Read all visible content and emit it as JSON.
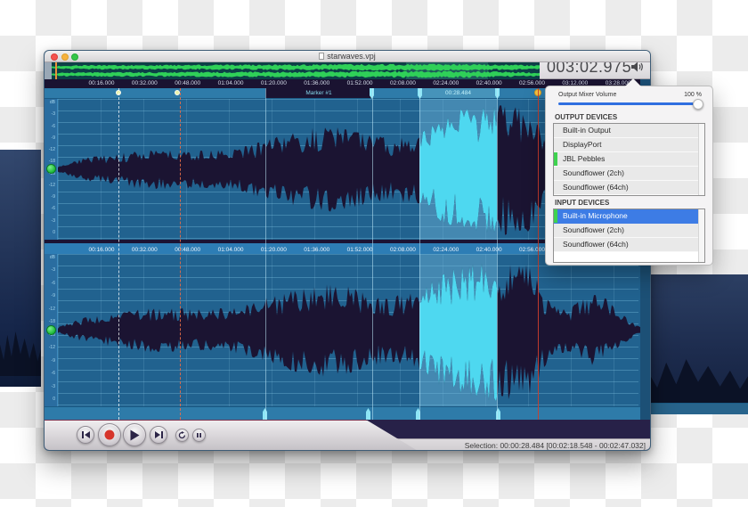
{
  "window": {
    "title": "starwaves.vpj",
    "time_display": "003:02.975",
    "traffic_lights": [
      "close",
      "minimize",
      "zoom"
    ],
    "ruler_ticks": [
      "00:16.000",
      "00:32.000",
      "00:48.000",
      "01:04.000",
      "01:20.000",
      "01:36.000",
      "01:52.000",
      "02:08.000",
      "02:24.000",
      "02:40.000",
      "02:56.000",
      "03:12.000",
      "03:28.000"
    ],
    "marker_label": "Marker #1",
    "selection_duration_label": "00:28.484",
    "db_labels": [
      "dB",
      "-3",
      "-6",
      "-9",
      "-12",
      "-18",
      "-18",
      "-12",
      "-9",
      "-6",
      "-3",
      "0"
    ],
    "status_text": "Selection: 00:00:28.484 [00:02:18.548 - 00:02:47.032]",
    "transport": [
      "skip-to-start",
      "record",
      "play",
      "skip-to-end",
      "loop",
      "pause"
    ]
  },
  "popover": {
    "volume_label": "Output Mixer Volume",
    "volume_value": "100 %",
    "output_header": "OUTPUT DEVICES",
    "input_header": "INPUT DEVICES",
    "output_devices": [
      {
        "name": "Built-in Output",
        "indicator": false,
        "selected": false
      },
      {
        "name": "DisplayPort",
        "indicator": false,
        "selected": false
      },
      {
        "name": "JBL Pebbles",
        "indicator": true,
        "selected": false
      },
      {
        "name": "Soundflower (2ch)",
        "indicator": false,
        "selected": false
      },
      {
        "name": "Soundflower (64ch)",
        "indicator": false,
        "selected": false
      }
    ],
    "input_devices": [
      {
        "name": "Built-in Microphone",
        "indicator": true,
        "selected": true
      },
      {
        "name": "Soundflower (2ch)",
        "indicator": false,
        "selected": false
      },
      {
        "name": "Soundflower (64ch)",
        "indicator": false,
        "selected": false
      }
    ]
  },
  "colors": {
    "waveform_dark": "#1b1432",
    "selection_cyan": "#4ed8f0",
    "overview_green": "#2fd058",
    "record_red": "#d6352b",
    "glyph_navy": "#2c2547",
    "device_active_green": "#3ed24f",
    "selected_row_blue": "#3d7ce5",
    "slider_blue": "#2f6fe0",
    "playhead_red": "#cd3e2c",
    "playhead_pin_yellow": "#f6c544"
  },
  "waveform_envelope": [
    [
      0,
      0.04
    ],
    [
      0.02,
      0.1
    ],
    [
      0.05,
      0.18
    ],
    [
      0.1,
      0.22
    ],
    [
      0.15,
      0.3
    ],
    [
      0.2,
      0.3
    ],
    [
      0.25,
      0.28
    ],
    [
      0.3,
      0.3
    ],
    [
      0.36,
      0.44
    ],
    [
      0.41,
      0.56
    ],
    [
      0.45,
      0.62
    ],
    [
      0.5,
      0.6
    ],
    [
      0.54,
      0.5
    ],
    [
      0.57,
      0.45
    ],
    [
      0.62,
      0.52
    ],
    [
      0.65,
      0.72
    ],
    [
      0.68,
      0.86
    ],
    [
      0.71,
      0.92
    ],
    [
      0.75,
      0.95
    ],
    [
      0.78,
      0.95
    ],
    [
      0.81,
      0.9
    ],
    [
      0.83,
      0.58
    ],
    [
      0.85,
      0.34
    ],
    [
      0.88,
      0.3
    ],
    [
      0.9,
      0.42
    ],
    [
      0.92,
      0.5
    ],
    [
      0.94,
      0.44
    ],
    [
      0.96,
      0.28
    ],
    [
      0.98,
      0.14
    ],
    [
      1,
      0.04
    ]
  ],
  "overview_envelope": [
    [
      0,
      0.25
    ],
    [
      0.03,
      0.55
    ],
    [
      0.1,
      0.6
    ],
    [
      0.2,
      0.62
    ],
    [
      0.35,
      0.7
    ],
    [
      0.5,
      0.72
    ],
    [
      0.65,
      0.85
    ],
    [
      0.8,
      0.9
    ],
    [
      0.93,
      0.75
    ],
    [
      1,
      0.5
    ]
  ]
}
